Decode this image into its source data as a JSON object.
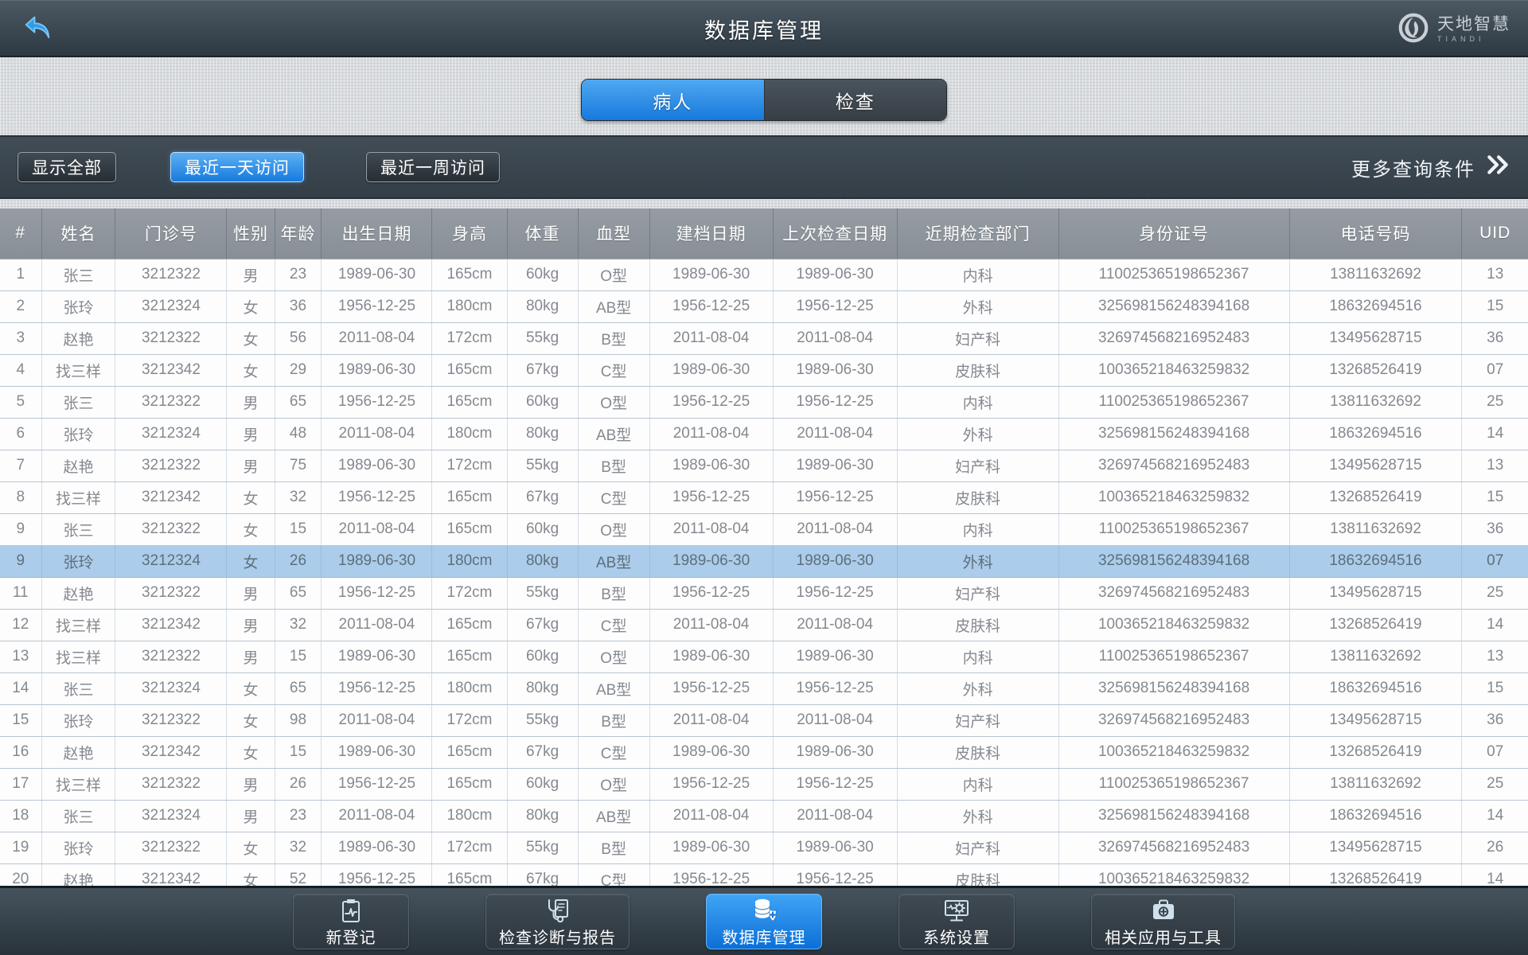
{
  "header": {
    "title": "数据库管理",
    "back_icon": "back-arrow",
    "logo": {
      "name_cn": "天地智慧",
      "name_en": "TIANDI",
      "icon": "flame-circle"
    }
  },
  "tabs": [
    {
      "label": "病人",
      "active": true
    },
    {
      "label": "检查",
      "active": false
    }
  ],
  "filters": {
    "show_all": "显示全部",
    "last_day": "最近一天访问",
    "last_week": "最近一周访问",
    "more_label": "更多查询条件",
    "active_filter": "最近一天访问"
  },
  "table": {
    "columns": [
      "#",
      "姓名",
      "门诊号",
      "性别",
      "年龄",
      "出生日期",
      "身高",
      "体重",
      "血型",
      "建档日期",
      "上次检查日期",
      "近期检查部门",
      "身份证号",
      "电话号码",
      "UID"
    ],
    "selected_row_index": 9,
    "rows": [
      [
        "1",
        "张三",
        "3212322",
        "男",
        "23",
        "1989-06-30",
        "165cm",
        "60kg",
        "O型",
        "1989-06-30",
        "1989-06-30",
        "内科",
        "110025365198652367",
        "13811632692",
        "13"
      ],
      [
        "2",
        "张玲",
        "3212324",
        "女",
        "36",
        "1956-12-25",
        "180cm",
        "80kg",
        "AB型",
        "1956-12-25",
        "1956-12-25",
        "外科",
        "325698156248394168",
        "18632694516",
        "15"
      ],
      [
        "3",
        "赵艳",
        "3212322",
        "女",
        "56",
        "2011-08-04",
        "172cm",
        "55kg",
        "B型",
        "2011-08-04",
        "2011-08-04",
        "妇产科",
        "326974568216952483",
        "13495628715",
        "36"
      ],
      [
        "4",
        "找三样",
        "3212342",
        "女",
        "29",
        "1989-06-30",
        "165cm",
        "67kg",
        "C型",
        "1989-06-30",
        "1989-06-30",
        "皮肤科",
        "100365218463259832",
        "13268526419",
        "07"
      ],
      [
        "5",
        "张三",
        "3212322",
        "男",
        "65",
        "1956-12-25",
        "165cm",
        "60kg",
        "O型",
        "1956-12-25",
        "1956-12-25",
        "内科",
        "110025365198652367",
        "13811632692",
        "25"
      ],
      [
        "6",
        "张玲",
        "3212324",
        "男",
        "48",
        "2011-08-04",
        "180cm",
        "80kg",
        "AB型",
        "2011-08-04",
        "2011-08-04",
        "外科",
        "325698156248394168",
        "18632694516",
        "14"
      ],
      [
        "7",
        "赵艳",
        "3212322",
        "男",
        "75",
        "1989-06-30",
        "172cm",
        "55kg",
        "B型",
        "1989-06-30",
        "1989-06-30",
        "妇产科",
        "326974568216952483",
        "13495628715",
        "13"
      ],
      [
        "8",
        "找三样",
        "3212342",
        "女",
        "32",
        "1956-12-25",
        "165cm",
        "67kg",
        "C型",
        "1956-12-25",
        "1956-12-25",
        "皮肤科",
        "100365218463259832",
        "13268526419",
        "15"
      ],
      [
        "9",
        "张三",
        "3212322",
        "女",
        "15",
        "2011-08-04",
        "165cm",
        "60kg",
        "O型",
        "2011-08-04",
        "2011-08-04",
        "内科",
        "110025365198652367",
        "13811632692",
        "36"
      ],
      [
        "9",
        "张玲",
        "3212324",
        "女",
        "26",
        "1989-06-30",
        "180cm",
        "80kg",
        "AB型",
        "1989-06-30",
        "1989-06-30",
        "外科",
        "325698156248394168",
        "18632694516",
        "07"
      ],
      [
        "11",
        "赵艳",
        "3212322",
        "男",
        "65",
        "1956-12-25",
        "172cm",
        "55kg",
        "B型",
        "1956-12-25",
        "1956-12-25",
        "妇产科",
        "326974568216952483",
        "13495628715",
        "25"
      ],
      [
        "12",
        "找三样",
        "3212342",
        "男",
        "32",
        "2011-08-04",
        "165cm",
        "67kg",
        "C型",
        "2011-08-04",
        "2011-08-04",
        "皮肤科",
        "100365218463259832",
        "13268526419",
        "14"
      ],
      [
        "13",
        "找三样",
        "3212322",
        "男",
        "15",
        "1989-06-30",
        "165cm",
        "60kg",
        "O型",
        "1989-06-30",
        "1989-06-30",
        "内科",
        "110025365198652367",
        "13811632692",
        "13"
      ],
      [
        "14",
        "张三",
        "3212324",
        "女",
        "65",
        "1956-12-25",
        "180cm",
        "80kg",
        "AB型",
        "1956-12-25",
        "1956-12-25",
        "外科",
        "325698156248394168",
        "18632694516",
        "15"
      ],
      [
        "15",
        "张玲",
        "3212322",
        "女",
        "98",
        "2011-08-04",
        "172cm",
        "55kg",
        "B型",
        "2011-08-04",
        "2011-08-04",
        "妇产科",
        "326974568216952483",
        "13495628715",
        "36"
      ],
      [
        "16",
        "赵艳",
        "3212342",
        "女",
        "15",
        "1989-06-30",
        "165cm",
        "67kg",
        "C型",
        "1989-06-30",
        "1989-06-30",
        "皮肤科",
        "100365218463259832",
        "13268526419",
        "07"
      ],
      [
        "17",
        "找三样",
        "3212322",
        "男",
        "26",
        "1956-12-25",
        "165cm",
        "60kg",
        "O型",
        "1956-12-25",
        "1956-12-25",
        "内科",
        "110025365198652367",
        "13811632692",
        "25"
      ],
      [
        "18",
        "张三",
        "3212324",
        "男",
        "23",
        "2011-08-04",
        "180cm",
        "80kg",
        "AB型",
        "2011-08-04",
        "2011-08-04",
        "外科",
        "325698156248394168",
        "18632694516",
        "14"
      ],
      [
        "19",
        "张玲",
        "3212322",
        "女",
        "32",
        "1989-06-30",
        "172cm",
        "55kg",
        "B型",
        "1989-06-30",
        "1989-06-30",
        "妇产科",
        "326974568216952483",
        "13495628715",
        "26"
      ],
      [
        "20",
        "赵艳",
        "3212342",
        "女",
        "52",
        "1956-12-25",
        "165cm",
        "67kg",
        "C型",
        "1956-12-25",
        "1956-12-25",
        "皮肤科",
        "100365218463259832",
        "13268526419",
        "14"
      ]
    ]
  },
  "nav": {
    "items": [
      {
        "label": "新登记",
        "icon": "clipboard-pulse-icon",
        "active": false
      },
      {
        "label": "检查诊断与报告",
        "icon": "stethoscope-report-icon",
        "active": false
      },
      {
        "label": "数据库管理",
        "icon": "database-plus-icon",
        "active": true
      },
      {
        "label": "系统设置",
        "icon": "monitor-gear-icon",
        "active": false
      },
      {
        "label": "相关应用与工具",
        "icon": "toolbox-plus-icon",
        "active": false
      }
    ]
  },
  "colors": {
    "accent_blue": "#2491e8",
    "selected_row": "#abccea",
    "topbar_dark": "#38444e",
    "table_header_gray": "#8d949b",
    "row_text_gray": "#85898e"
  }
}
